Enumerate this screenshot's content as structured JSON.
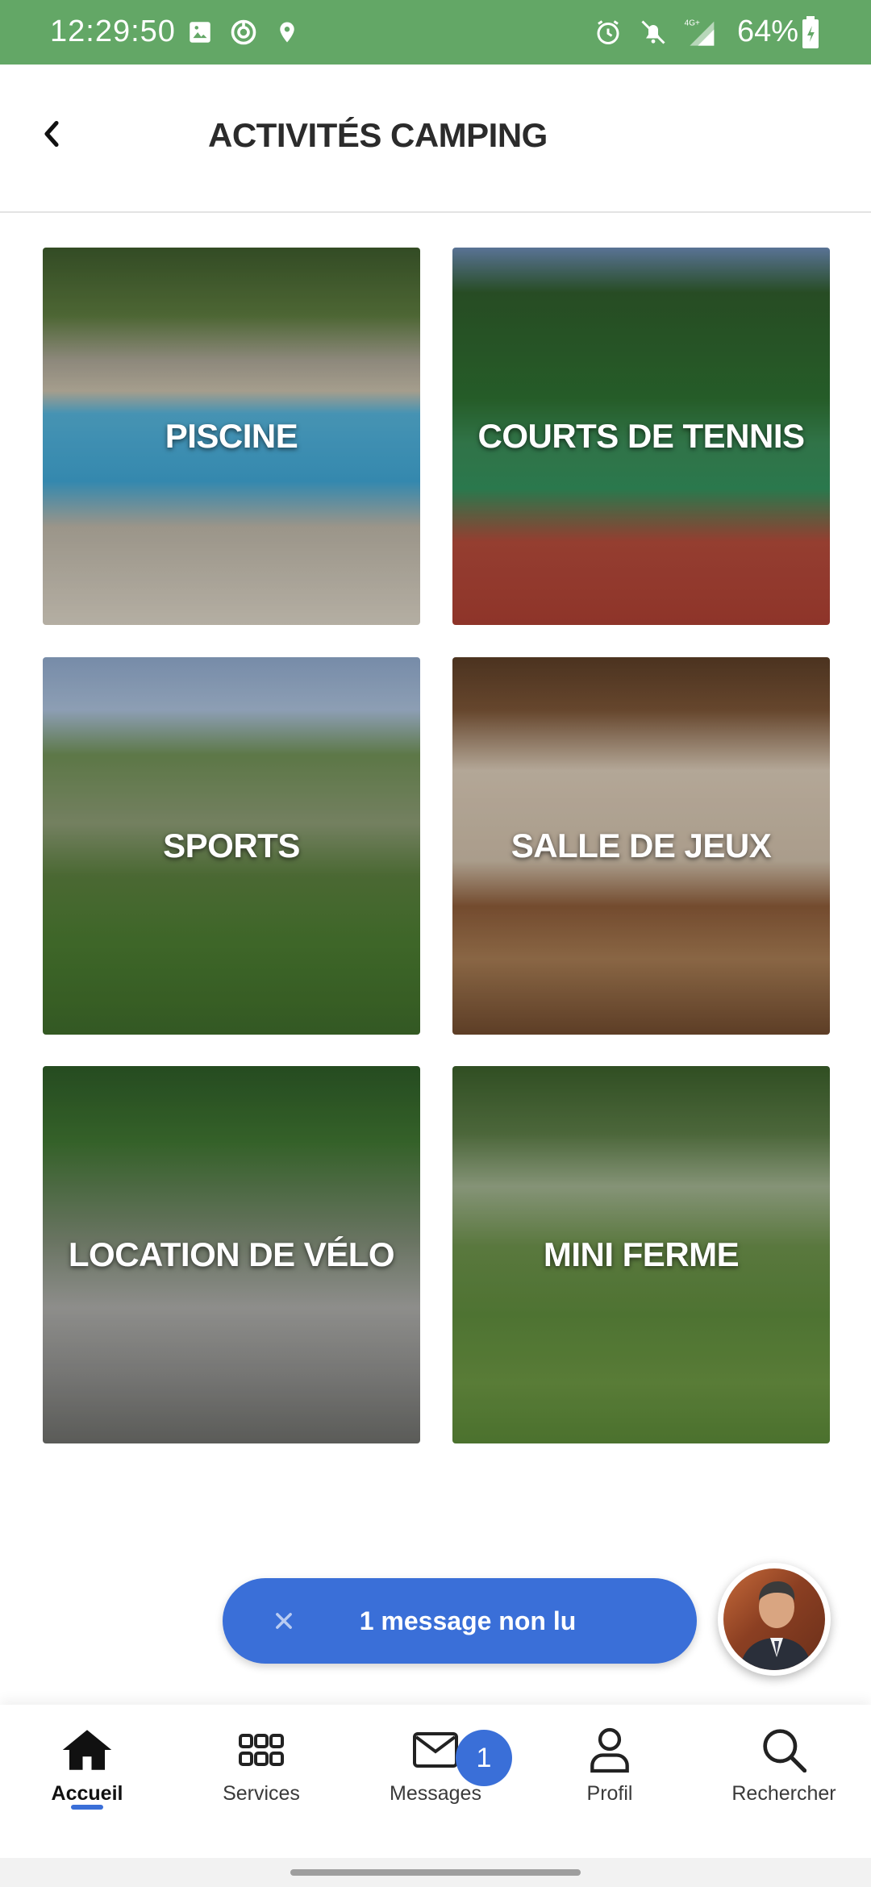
{
  "status_bar": {
    "time": "12:29:50",
    "network": "4G+",
    "battery": "64%",
    "icons": [
      "image-icon",
      "vpn-icon",
      "location-icon",
      "alarm-icon",
      "bell-off-icon",
      "signal-icon",
      "battery-icon"
    ]
  },
  "header": {
    "title": "ACTIVITÉS CAMPING",
    "back_icon": "chevron-left-icon"
  },
  "tiles": [
    {
      "label": "PISCINE"
    },
    {
      "label": "COURTS DE TENNIS"
    },
    {
      "label": "SPORTS"
    },
    {
      "label": "SALLE DE JEUX"
    },
    {
      "label": "LOCATION DE VÉLO"
    },
    {
      "label": "MINI FERME"
    }
  ],
  "unread": {
    "text": "1 message non lu",
    "close_icon": "close-icon"
  },
  "nav": {
    "items": [
      {
        "label": "Accueil",
        "icon": "home-icon",
        "active": true
      },
      {
        "label": "Services",
        "icon": "grid-icon",
        "active": false
      },
      {
        "label": "Messages",
        "icon": "envelope-icon",
        "active": false,
        "badge": "1"
      },
      {
        "label": "Profil",
        "icon": "user-icon",
        "active": false
      },
      {
        "label": "Rechercher",
        "icon": "search-icon",
        "active": false
      }
    ]
  },
  "colors": {
    "status_bar": "#63a766",
    "accent": "#3a6fd8",
    "title": "#2b2b2b"
  }
}
